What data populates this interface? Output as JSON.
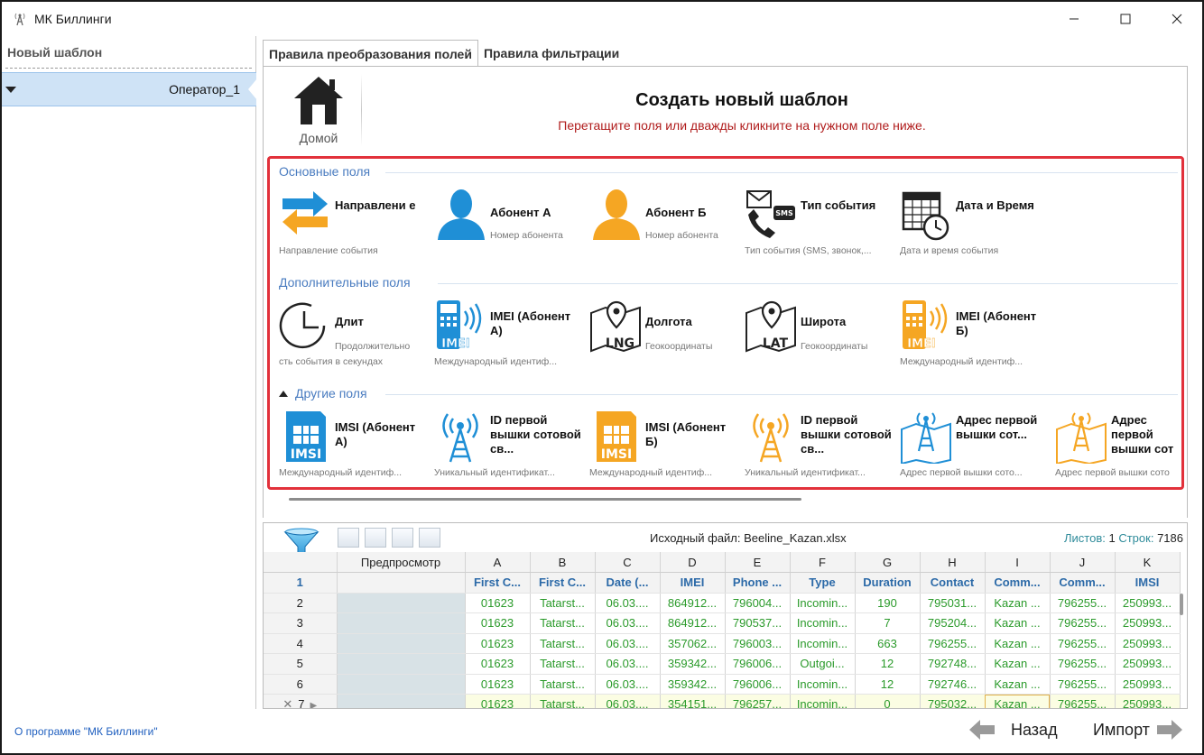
{
  "window": {
    "title": "МК Биллинги"
  },
  "left_panel": {
    "header": "Новый шаблон",
    "operator": "Оператор_1"
  },
  "tabs": [
    {
      "label": "Правила преобразования полей",
      "active": true
    },
    {
      "label": "Правила фильтрации",
      "active": false
    }
  ],
  "home": {
    "label": "Домой"
  },
  "create": {
    "title": "Создать новый шаблон",
    "subtitle": "Перетащите поля или дважды кликните на нужном поле ниже."
  },
  "sections": {
    "main": "Основные поля",
    "extra": "Дополнительные поля",
    "other": "Другие поля"
  },
  "main_fields": [
    {
      "name": "Направлени е",
      "desc": "Направление события",
      "icon": "direction-arrows-icon"
    },
    {
      "name": "Абонент А",
      "desc": "Номер абонента",
      "icon": "subscriber-a-icon"
    },
    {
      "name": "Абонент Б",
      "desc": "Номер абонента",
      "icon": "subscriber-b-icon"
    },
    {
      "name": "Тип события",
      "desc": "Тип события (SMS, звонок,...",
      "icon": "sms-phone-icon"
    },
    {
      "name": "Дата и Время",
      "desc": "Дата и время события",
      "icon": "calendar-clock-icon"
    }
  ],
  "extra_fields": [
    {
      "name": "Длит",
      "desc_a": "Продолжительно",
      "desc": "сть события в секундах",
      "icon": "clock-icon"
    },
    {
      "name": "IMEI (Абонент А)",
      "desc": "Международный идентиф...",
      "icon": "imei-a-icon"
    },
    {
      "name": "Долгота",
      "desc_a": "Геокоординаты",
      "desc": "",
      "icon": "longitude-map-icon"
    },
    {
      "name": "Широта",
      "desc_a": "Геокоординаты",
      "desc": "",
      "icon": "latitude-map-icon"
    },
    {
      "name": "IMEI (Абонент Б)",
      "desc": "Международный идентиф...",
      "icon": "imei-b-icon"
    }
  ],
  "other_fields": [
    {
      "name": "IMSI (Абонент А)",
      "desc": "Международный идентиф...",
      "icon": "imsi-a-icon"
    },
    {
      "name": "ID первой вышки сотовой св...",
      "desc": "Уникальный идентификат...",
      "icon": "tower-a-icon"
    },
    {
      "name": "IMSI (Абонент Б)",
      "desc": "Международный идентиф...",
      "icon": "imsi-b-icon"
    },
    {
      "name": "ID первой вышки сотовой св...",
      "desc": "Уникальный идентификат...",
      "icon": "tower-b-icon"
    },
    {
      "name": "Адрес первой вышки сот...",
      "desc": "Адрес первой вышки сото...",
      "icon": "tower-address-a-icon"
    },
    {
      "name": "Адрес первой вышки сот",
      "desc": "Адрес первой вышки сото",
      "icon": "tower-address-b-icon"
    }
  ],
  "grid": {
    "source_label": "Исходный файл: Beeline_Kazan.xlsx",
    "sheets_label": "Листов:",
    "sheets_value": "1",
    "rows_label": "Строк:",
    "rows_value": "7186",
    "preview_header": "Предпросмотр",
    "letters": [
      "A",
      "B",
      "C",
      "D",
      "E",
      "F",
      "G",
      "H",
      "I",
      "J",
      "K"
    ],
    "colnames": [
      "First C...",
      "First C...",
      "Date (...",
      "IMEI",
      "Phone ...",
      "Type",
      "Duration",
      "Contact",
      "Comm...",
      "Comm...",
      "IMSI"
    ],
    "rows": [
      {
        "n": "2",
        "cells": [
          "01623",
          "Tatarst...",
          "06.03....",
          "864912...",
          "796004...",
          "Incomin...",
          "190",
          "795031...",
          "Kazan ...",
          "796255...",
          "250993..."
        ]
      },
      {
        "n": "3",
        "cells": [
          "01623",
          "Tatarst...",
          "06.03....",
          "864912...",
          "790537...",
          "Incomin...",
          "7",
          "795204...",
          "Kazan ...",
          "796255...",
          "250993..."
        ]
      },
      {
        "n": "4",
        "cells": [
          "01623",
          "Tatarst...",
          "06.03....",
          "357062...",
          "796003...",
          "Incomin...",
          "663",
          "796255...",
          "Kazan ...",
          "796255...",
          "250993..."
        ]
      },
      {
        "n": "5",
        "cells": [
          "01623",
          "Tatarst...",
          "06.03....",
          "359342...",
          "796006...",
          "Outgoi...",
          "12",
          "792748...",
          "Kazan ...",
          "796255...",
          "250993..."
        ]
      },
      {
        "n": "6",
        "cells": [
          "01623",
          "Tatarst...",
          "06.03....",
          "359342...",
          "796006...",
          "Incomin...",
          "12",
          "792746...",
          "Kazan ...",
          "796255...",
          "250993..."
        ]
      },
      {
        "n": "7",
        "cells": [
          "01623",
          "Tatarst...",
          "06.03....",
          "354151...",
          "796257...",
          "Incomin...",
          "0",
          "795032...",
          "Kazan ...",
          "796255...",
          "250993..."
        ]
      }
    ],
    "header_row_number": "1"
  },
  "footer": {
    "about": "О программе \"МК Биллинги\"",
    "back": "Назад",
    "import": "Импорт"
  },
  "colors": {
    "accent_blue": "#1f8fd6",
    "accent_orange": "#f5a623",
    "highlight_red": "#e2313b"
  }
}
